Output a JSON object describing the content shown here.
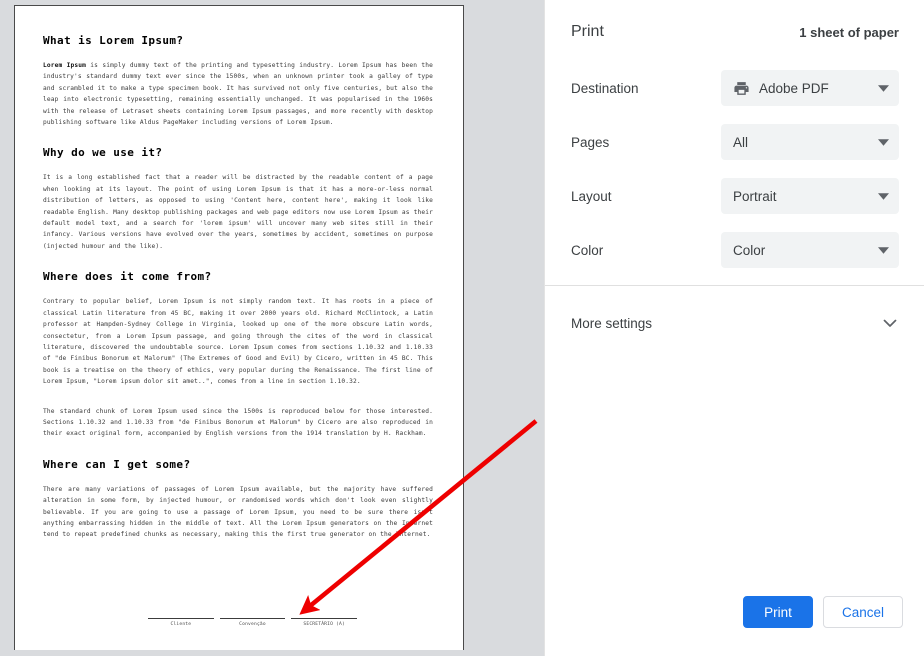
{
  "preview": {
    "document": {
      "sections": [
        {
          "heading": "What is Lorem Ipsum?",
          "paragraph_lead": "Lorem Ipsum",
          "paragraph": " is simply dummy text of the printing and typesetting industry. Lorem Ipsum has been the industry's standard dummy text ever since the 1500s, when an unknown printer took a galley of type and scrambled it to make a type specimen book. It has survived not only five centuries, but also the leap into electronic typesetting, remaining essentially unchanged. It was popularised in the 1960s with the release of Letraset sheets containing Lorem Ipsum passages, and more recently with desktop publishing software like Aldus PageMaker including versions of Lorem Ipsum."
        },
        {
          "heading": "Why do we use it?",
          "paragraph": "It is a long established fact that a reader will be distracted by the readable content of a page when looking at its layout. The point of using Lorem Ipsum is that it has a more-or-less normal distribution of letters, as opposed to using 'Content here, content here', making it look like readable English. Many desktop publishing packages and web page editors now use Lorem Ipsum as their default model text, and a search for 'lorem ipsum' will uncover many web sites still in their infancy. Various versions have evolved over the years, sometimes by accident, sometimes on purpose (injected humour and the like)."
        },
        {
          "heading": "Where does it come from?",
          "paragraph": "Contrary to popular belief, Lorem Ipsum is not simply random text. It has roots in a piece of classical Latin literature from 45 BC, making it over 2000 years old. Richard McClintock, a Latin professor at Hampden-Sydney College in Virginia, looked up one of the more obscure Latin words, consectetur, from a Lorem Ipsum passage, and going through the cites of the word in classical literature, discovered the undoubtable source. Lorem Ipsum comes from sections 1.10.32 and 1.10.33 of \"de Finibus Bonorum et Malorum\" (The Extremes of Good and Evil) by Cicero, written in 45 BC. This book is a treatise on the theory of ethics, very popular during the Renaissance. The first line of Lorem Ipsum, \"Lorem ipsum dolor sit amet..\", comes from a line in section 1.10.32.",
          "paragraph2": "The standard chunk of Lorem Ipsum used since the 1500s is reproduced below for those interested. Sections 1.10.32 and 1.10.33 from \"de Finibus Bonorum et Malorum\" by Cicero are also reproduced in their exact original form, accompanied by English versions from the 1914 translation by H. Rackham."
        },
        {
          "heading": "Where can I get some?",
          "paragraph": "There are many variations of passages of Lorem Ipsum available, but the majority have suffered alteration in some form, by injected humour, or randomised words which don't look even slightly believable. If you are going to use a passage of Lorem Ipsum, you need to be sure there isn't anything embarrassing hidden in the middle of text. All the Lorem Ipsum generators on the Internet tend to repeat predefined chunks as necessary, making this the first true generator on the Internet."
        }
      ],
      "signature_labels": [
        "Cliente",
        "Convenção",
        "SECRETÁRIO (A)"
      ]
    },
    "annotation": {
      "arrow_color": "#ee0000",
      "arrow_from": "536,421",
      "arrow_to": "303,612"
    }
  },
  "panel": {
    "title": "Print",
    "sheet_count": "1 sheet of paper",
    "settings": [
      {
        "label": "Destination",
        "value": "Adobe PDF",
        "icon": "printer-icon"
      },
      {
        "label": "Pages",
        "value": "All",
        "icon": ""
      },
      {
        "label": "Layout",
        "value": "Portrait",
        "icon": ""
      },
      {
        "label": "Color",
        "value": "Color",
        "icon": ""
      }
    ],
    "more_settings": {
      "label": "More settings",
      "icon": "chevron-down-icon"
    },
    "actions": {
      "print_label": "Print",
      "cancel_label": "Cancel"
    },
    "colors": {
      "accent": "#1a73e8",
      "field_bg": "#f1f3f4",
      "text": "#3c4043"
    }
  }
}
